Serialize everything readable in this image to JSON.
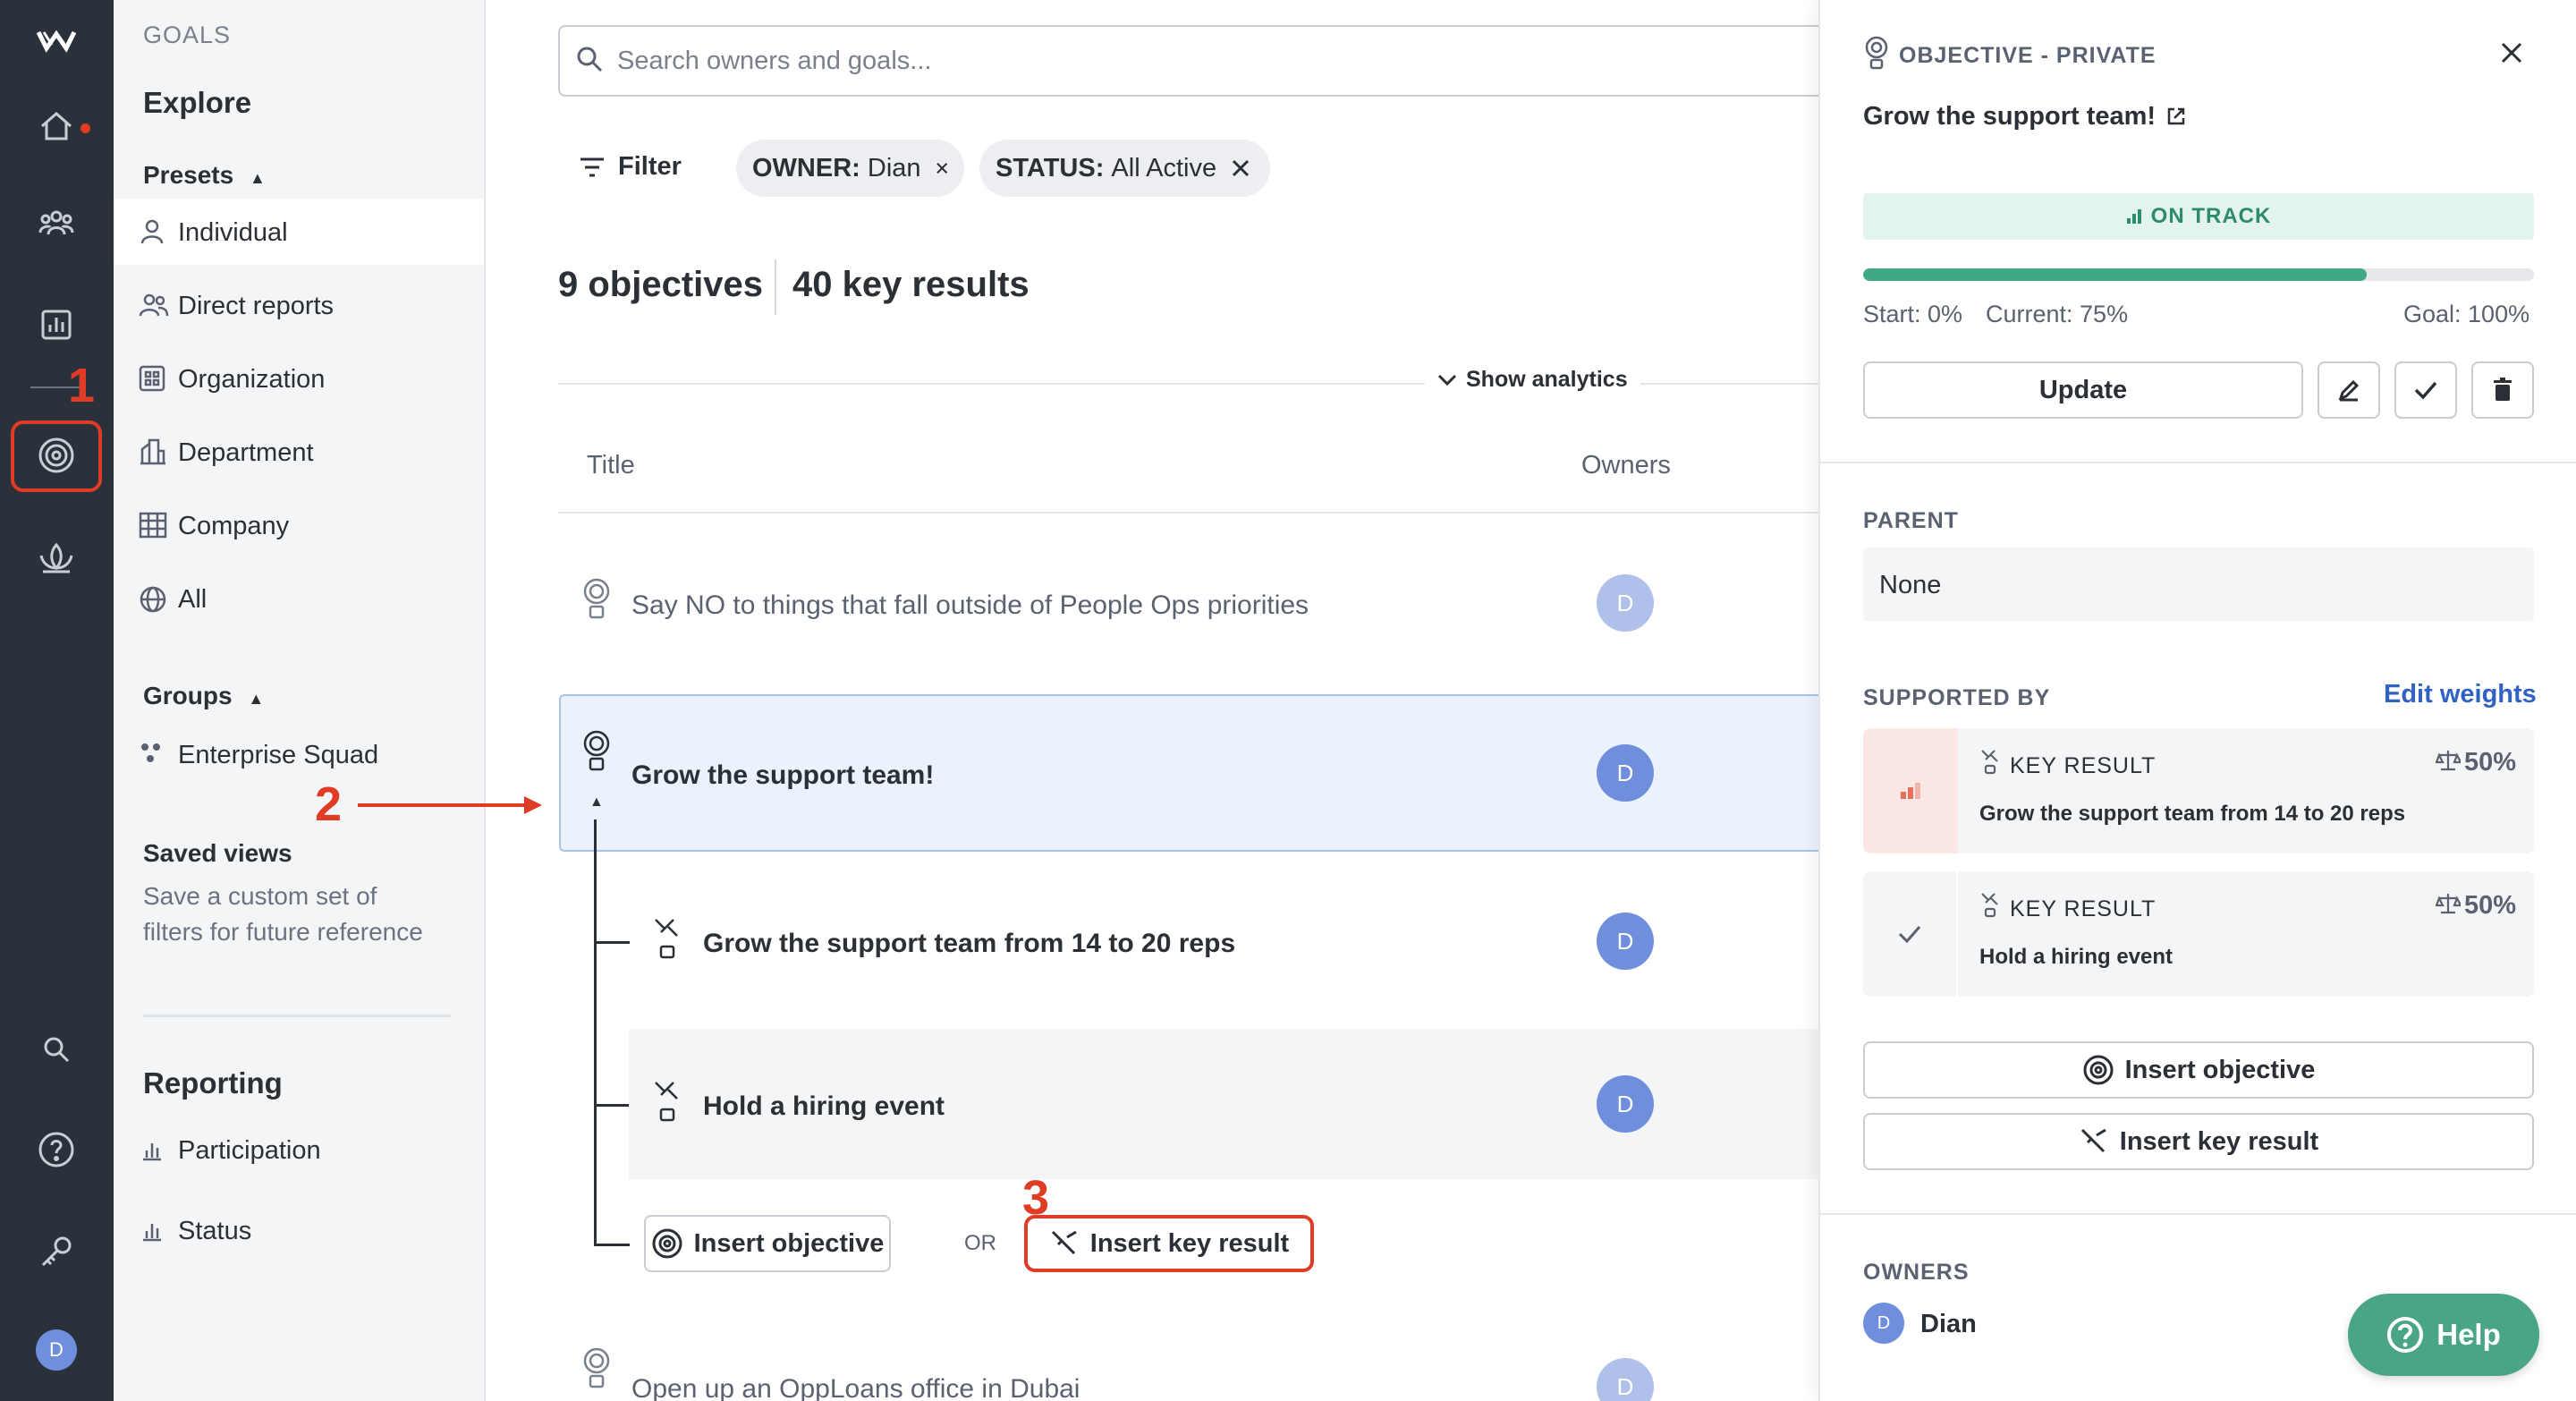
{
  "rail": {
    "avatar_initial": "D",
    "notification_color": "#e03b24"
  },
  "sidebar": {
    "section_title": "GOALS",
    "explore": "Explore",
    "presets_header": "Presets",
    "presets": [
      {
        "label": "Individual",
        "icon": "person-icon"
      },
      {
        "label": "Direct reports",
        "icon": "people-icon"
      },
      {
        "label": "Organization",
        "icon": "org-grid-icon"
      },
      {
        "label": "Department",
        "icon": "building-icon"
      },
      {
        "label": "Company",
        "icon": "company-icon"
      },
      {
        "label": "All",
        "icon": "globe-icon"
      }
    ],
    "groups_header": "Groups",
    "groups": [
      {
        "label": "Enterprise Squad"
      }
    ],
    "saved_views_title": "Saved views",
    "saved_views_desc_1": "Save a custom set of",
    "saved_views_desc_2": "filters for future reference",
    "reporting_title": "Reporting",
    "reporting_items": [
      {
        "label": "Participation"
      },
      {
        "label": "Status"
      }
    ]
  },
  "main": {
    "search_placeholder": "Search owners and goals...",
    "filter_label": "Filter",
    "chips": [
      {
        "key": "OWNER:",
        "value": "Dian"
      },
      {
        "key": "STATUS:",
        "value": "All Active"
      }
    ],
    "objectives_count": "9 objectives",
    "key_results_count": "40 key results",
    "show_analytics": "Show analytics",
    "col_title": "Title",
    "col_owners": "Owners",
    "rows": [
      {
        "title": "Say NO to things that fall outside of People Ops priorities",
        "owner": "D"
      },
      {
        "title": "Grow the support team!",
        "owner": "D"
      },
      {
        "title": "Grow the support team from 14 to 20 reps",
        "owner": "D"
      },
      {
        "title": "Hold a hiring event",
        "owner": "D"
      },
      {
        "title": "Open up an OppLoans office in Dubai",
        "owner": "D"
      }
    ],
    "insert_objective": "Insert objective",
    "or": "OR",
    "insert_key_result": "Insert key result"
  },
  "annotations": {
    "step1": "1",
    "step2": "2",
    "step3": "3",
    "color": "#e03b24"
  },
  "panel": {
    "type_label": "OBJECTIVE - PRIVATE",
    "title": "Grow the support team!",
    "status": "ON TRACK",
    "status_color": "#2e8b6a",
    "progress": 0.75,
    "start": "Start: 0%",
    "current": "Current: 75%",
    "goal": "Goal: 100%",
    "update_label": "Update",
    "parent_label": "PARENT",
    "parent_value": "None",
    "supported_by_label": "SUPPORTED BY",
    "edit_weights": "Edit weights",
    "key_results": [
      {
        "type": "KEY RESULT",
        "weight": "50%",
        "title": "Grow the support team from 14 to 20 reps"
      },
      {
        "type": "KEY RESULT",
        "weight": "50%",
        "title": "Hold a hiring event"
      }
    ],
    "insert_objective": "Insert objective",
    "insert_key_result": "Insert key result",
    "owners_label": "OWNERS",
    "owner_initial": "D",
    "owner_name": "Dian",
    "help_label": "Help",
    "help_color": "#4aa587"
  }
}
